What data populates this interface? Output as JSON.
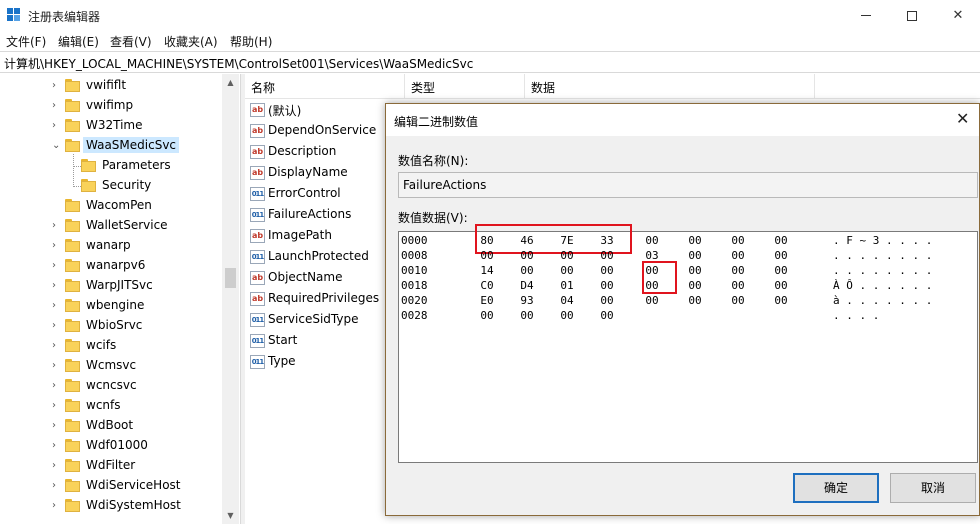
{
  "window": {
    "title": "注册表编辑器",
    "minimize": "—",
    "maximize": "□",
    "close": "✕",
    "icon": "regedit-icon"
  },
  "menu": [
    "文件(F)",
    "编辑(E)",
    "查看(V)",
    "收藏夹(A)",
    "帮助(H)"
  ],
  "address": "计算机\\HKEY_LOCAL_MACHINE\\SYSTEM\\ControlSet001\\Services\\WaaSMedicSvc",
  "tree": {
    "items": [
      {
        "label": "vwififlt",
        "level": 0,
        "expandable": true,
        "expanded": false
      },
      {
        "label": "vwifimp",
        "level": 0,
        "expandable": true,
        "expanded": false
      },
      {
        "label": "W32Time",
        "level": 0,
        "expandable": true,
        "expanded": false
      },
      {
        "label": "WaaSMedicSvc",
        "level": 0,
        "expandable": true,
        "expanded": true,
        "selected": true
      },
      {
        "label": "Parameters",
        "level": 1,
        "expandable": false,
        "expanded": false
      },
      {
        "label": "Security",
        "level": 1,
        "expandable": false,
        "expanded": false
      },
      {
        "label": "WacomPen",
        "level": 0,
        "expandable": false,
        "expanded": false
      },
      {
        "label": "WalletService",
        "level": 0,
        "expandable": true,
        "expanded": false
      },
      {
        "label": "wanarp",
        "level": 0,
        "expandable": true,
        "expanded": false
      },
      {
        "label": "wanarpv6",
        "level": 0,
        "expandable": true,
        "expanded": false
      },
      {
        "label": "WarpJITSvc",
        "level": 0,
        "expandable": true,
        "expanded": false
      },
      {
        "label": "wbengine",
        "level": 0,
        "expandable": true,
        "expanded": false
      },
      {
        "label": "WbioSrvc",
        "level": 0,
        "expandable": true,
        "expanded": false
      },
      {
        "label": "wcifs",
        "level": 0,
        "expandable": true,
        "expanded": false
      },
      {
        "label": "Wcmsvc",
        "level": 0,
        "expandable": true,
        "expanded": false
      },
      {
        "label": "wcncsvc",
        "level": 0,
        "expandable": true,
        "expanded": false
      },
      {
        "label": "wcnfs",
        "level": 0,
        "expandable": true,
        "expanded": false
      },
      {
        "label": "WdBoot",
        "level": 0,
        "expandable": true,
        "expanded": false
      },
      {
        "label": "Wdf01000",
        "level": 0,
        "expandable": true,
        "expanded": false
      },
      {
        "label": "WdFilter",
        "level": 0,
        "expandable": true,
        "expanded": false
      },
      {
        "label": "WdiServiceHost",
        "level": 0,
        "expandable": true,
        "expanded": false
      },
      {
        "label": "WdiSystemHost",
        "level": 0,
        "expandable": true,
        "expanded": false
      }
    ]
  },
  "list": {
    "columns": [
      "名称",
      "类型",
      "数据"
    ],
    "rows": [
      {
        "name": "(默认)",
        "kind": "string"
      },
      {
        "name": "DependOnService",
        "kind": "string"
      },
      {
        "name": "Description",
        "kind": "string"
      },
      {
        "name": "DisplayName",
        "kind": "string"
      },
      {
        "name": "ErrorControl",
        "kind": "binary"
      },
      {
        "name": "FailureActions",
        "kind": "binary"
      },
      {
        "name": "ImagePath",
        "kind": "string"
      },
      {
        "name": "LaunchProtected",
        "kind": "binary"
      },
      {
        "name": "ObjectName",
        "kind": "string"
      },
      {
        "name": "RequiredPrivileges",
        "kind": "string"
      },
      {
        "name": "ServiceSidType",
        "kind": "binary"
      },
      {
        "name": "Start",
        "kind": "binary"
      },
      {
        "name": "Type",
        "kind": "binary"
      }
    ]
  },
  "dialog": {
    "title": "编辑二进制数值",
    "name_label": "数值名称(N):",
    "name_value": "FailureActions",
    "data_label": "数值数据(V):",
    "ok": "确定",
    "cancel": "取消",
    "hex_rows": [
      {
        "addr": "0000",
        "bytes": [
          "80",
          "46",
          "7E",
          "33",
          "00",
          "00",
          "00",
          "00"
        ],
        "ascii": ". F ~ 3 . . . ."
      },
      {
        "addr": "0008",
        "bytes": [
          "00",
          "00",
          "00",
          "00",
          "03",
          "00",
          "00",
          "00"
        ],
        "ascii": ". . . . . . . ."
      },
      {
        "addr": "0010",
        "bytes": [
          "14",
          "00",
          "00",
          "00",
          "00",
          "00",
          "00",
          "00"
        ],
        "ascii": ". . . . . . . ."
      },
      {
        "addr": "0018",
        "bytes": [
          "C0",
          "D4",
          "01",
          "00",
          "00",
          "00",
          "00",
          "00"
        ],
        "ascii": "À Ô . . . . . ."
      },
      {
        "addr": "0020",
        "bytes": [
          "E0",
          "93",
          "04",
          "00",
          "00",
          "00",
          "00",
          "00"
        ],
        "ascii": "à . . . . . . ."
      },
      {
        "addr": "0028",
        "bytes": [
          "00",
          "00",
          "00",
          "00"
        ],
        "ascii": ". . . ."
      }
    ]
  },
  "colors": {
    "selection": "#cce8ff",
    "highlight_box": "#e0141e",
    "ok_border": "#1e6fbf"
  }
}
